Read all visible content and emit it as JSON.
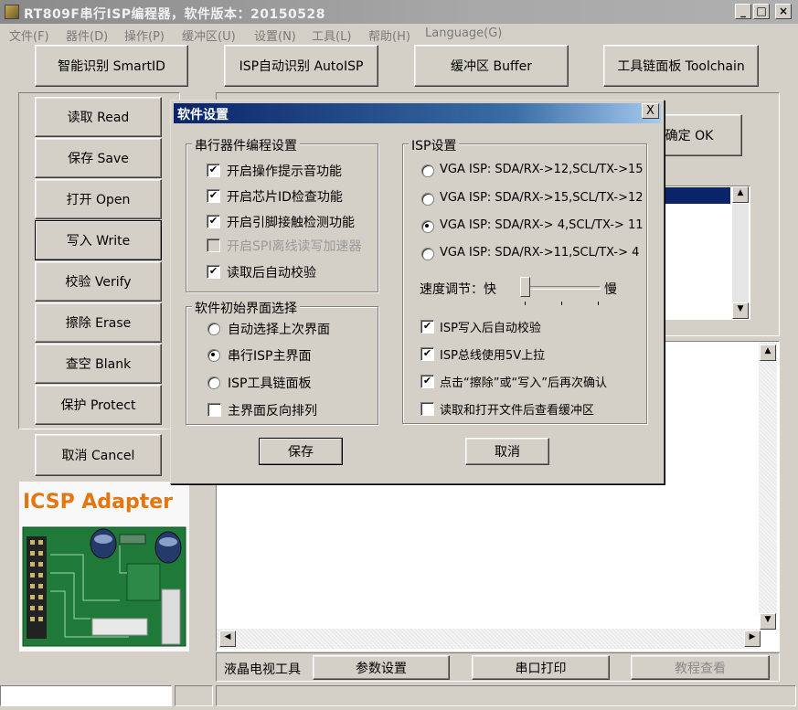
{
  "window": {
    "title": "RT809F串行ISP编程器，软件版本：20150528"
  },
  "menu": [
    "文件(F)",
    "器件(D)",
    "操作(P)",
    "缓冲区(U)",
    "设置(N)",
    "工具(L)",
    "帮助(H)",
    "Language(G)"
  ],
  "toolbar": {
    "smartid": "智能识别 SmartID",
    "autoisp": "ISP自动识别 AutoISP",
    "buffer": "缓冲区 Buffer",
    "toolchain": "工具链面板 Toolchain"
  },
  "side_buttons": {
    "read": "读取 Read",
    "save": "保存 Save",
    "open": "打开 Open",
    "write": "写入 Write",
    "verify": "校验 Verify",
    "erase": "擦除 Erase",
    "blank": "查空 Blank",
    "protect": "保护 Protect",
    "cancel": "取消 Cancel"
  },
  "ok_button": "确定 OK",
  "adapter": {
    "label": "ICSP Adapter"
  },
  "bottom_bar": {
    "label": "液晶电视工具",
    "param": "参数设置",
    "serial": "串口打印",
    "tutorial": "教程查看"
  },
  "dialog": {
    "title": "软件设置",
    "close": "X",
    "group_serial": {
      "title": "串行器件编程设置",
      "items": [
        {
          "label": "开启操作提示音功能",
          "checked": true,
          "enabled": true
        },
        {
          "label": "开启芯片ID检查功能",
          "checked": true,
          "enabled": true
        },
        {
          "label": "开启引脚接触检测功能",
          "checked": true,
          "enabled": true
        },
        {
          "label": "开启SPI离线读写加速器",
          "checked": false,
          "enabled": false
        },
        {
          "label": "读取后自动校验",
          "checked": true,
          "enabled": true
        }
      ]
    },
    "group_init": {
      "title": "软件初始界面选择",
      "radios": [
        {
          "label": "自动选择上次界面",
          "selected": false
        },
        {
          "label": "串行ISP主界面",
          "selected": true
        },
        {
          "label": "ISP工具链面板",
          "selected": false
        }
      ],
      "checkbox": {
        "label": "主界面反向排列",
        "checked": false
      }
    },
    "group_isp": {
      "title": "ISP设置",
      "radios": [
        {
          "label": "VGA ISP: SDA/RX->12,SCL/TX->15",
          "selected": false
        },
        {
          "label": "VGA ISP: SDA/RX->15,SCL/TX->12",
          "selected": false
        },
        {
          "label": "VGA ISP: SDA/RX-> 4,SCL/TX-> 11",
          "selected": true
        },
        {
          "label": "VGA ISP: SDA/RX->11,SCL/TX-> 4",
          "selected": false
        }
      ],
      "speed": {
        "label": "速度调节：快",
        "slow": "慢",
        "level": 0
      },
      "checks": [
        {
          "label": "ISP写入后自动校验",
          "checked": true
        },
        {
          "label": "ISP总线使用5V上拉",
          "checked": true
        },
        {
          "label": "点击“擦除”或“写入”后再次确认",
          "checked": true
        },
        {
          "label": "读取和打开文件后查看缓冲区",
          "checked": false
        }
      ]
    },
    "save": "保存",
    "cancel": "取消"
  }
}
